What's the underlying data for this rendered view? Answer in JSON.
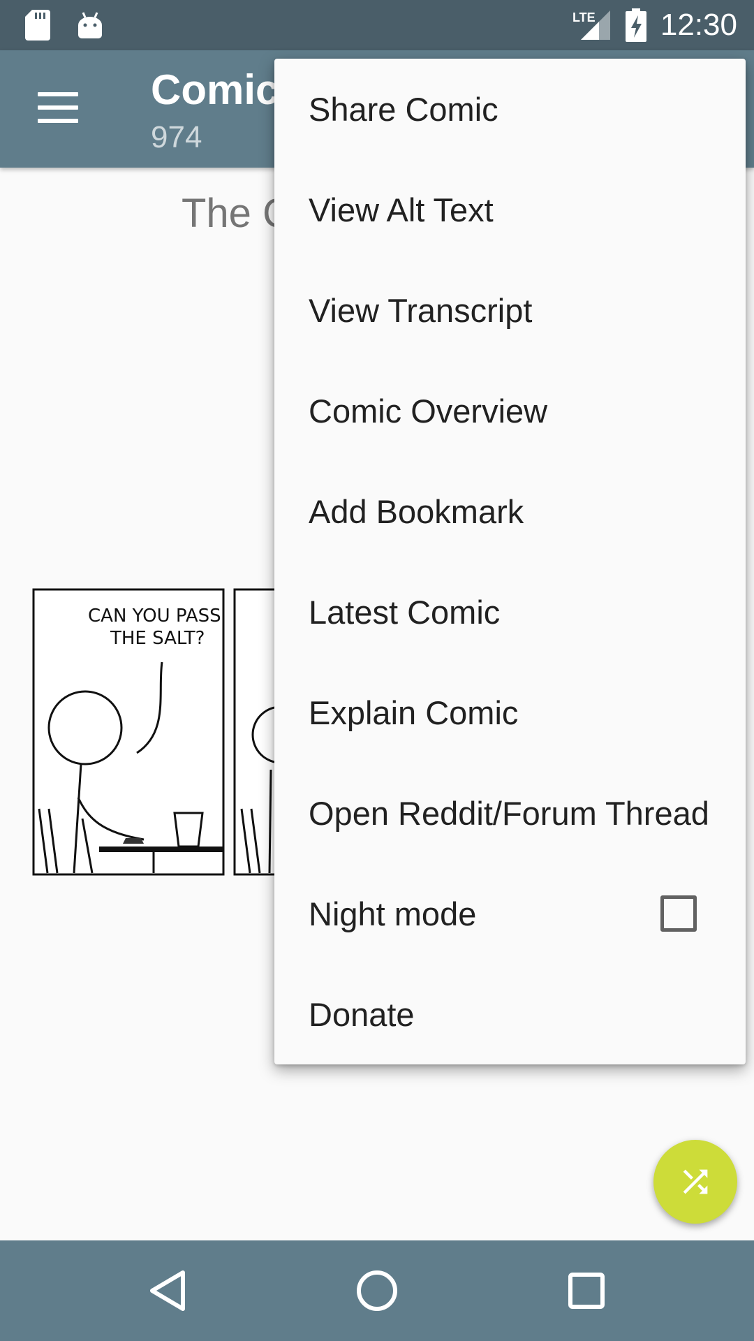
{
  "status_bar": {
    "icons": [
      "sd-card-icon",
      "android-icon",
      "lte-signal-icon",
      "battery-charging-icon"
    ],
    "lte_label": "LTE",
    "time": "12:30",
    "color": "#4a5e69"
  },
  "app_bar": {
    "title": "Comics",
    "subtitle": "974",
    "color": "#607d8b"
  },
  "comic": {
    "title": "The C",
    "panel_text_line1": "CAN YOU PASS",
    "panel_text_line2": "THE SALT?"
  },
  "menu": {
    "items": [
      {
        "label": "Share Comic"
      },
      {
        "label": "View Alt Text"
      },
      {
        "label": "View Transcript"
      },
      {
        "label": "Comic Overview"
      },
      {
        "label": "Add Bookmark"
      },
      {
        "label": "Latest Comic"
      },
      {
        "label": "Explain Comic"
      },
      {
        "label": "Open Reddit/Forum Thread"
      },
      {
        "label": "Night mode",
        "checkbox": false
      },
      {
        "label": "Donate"
      }
    ]
  },
  "fab": {
    "icon": "shuffle-icon",
    "color": "#cddc39"
  },
  "nav_bar": {
    "icons": [
      "back-icon",
      "home-icon",
      "recents-icon"
    ],
    "color": "#607d8b"
  }
}
